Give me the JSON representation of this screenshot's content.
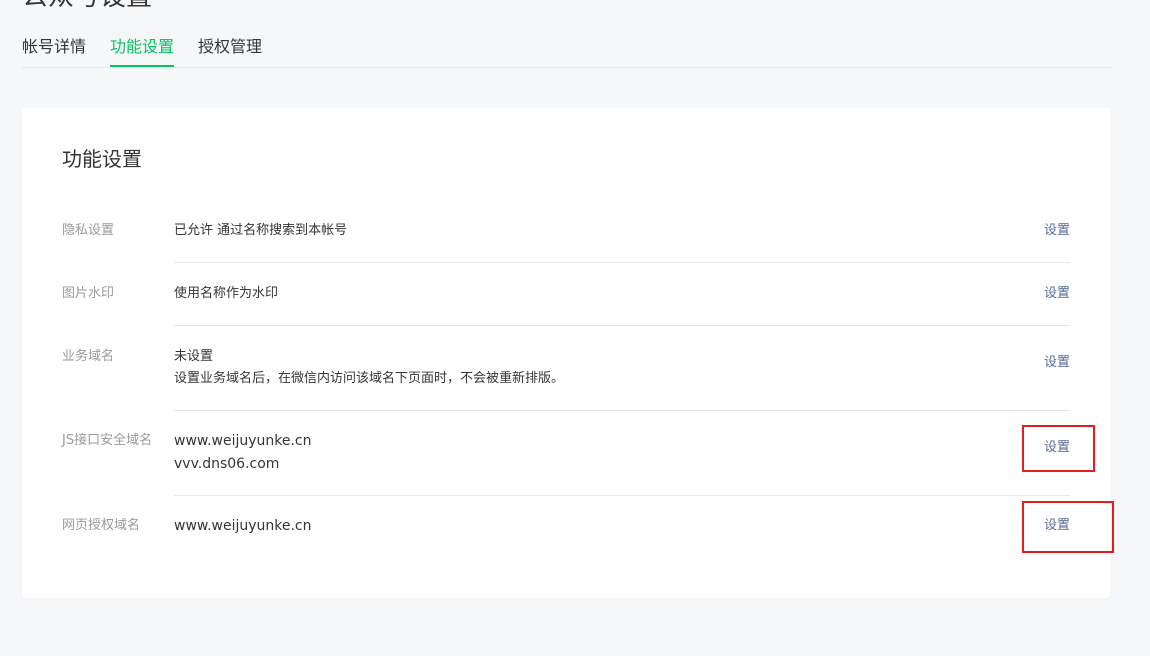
{
  "header": {
    "title": "公众号设置"
  },
  "tabs": [
    {
      "label": "帐号详情"
    },
    {
      "label": "功能设置"
    },
    {
      "label": "授权管理"
    }
  ],
  "active_tab": "功能设置",
  "card": {
    "title": "功能设置",
    "rows": [
      {
        "label": "隐私设置",
        "value_lines": [
          "已允许 通过名称搜索到本帐号"
        ],
        "action": "设置"
      },
      {
        "label": "图片水印",
        "value_lines": [
          "使用名称作为水印"
        ],
        "action": "设置"
      },
      {
        "label": "业务域名",
        "value_lines": [
          "未设置",
          "设置业务域名后，在微信内访问该域名下页面时，不会被重新排版。"
        ],
        "action": "设置"
      },
      {
        "label": "JS接口安全域名",
        "value_lines": [
          "www.weijuyunke.cn",
          "vvv.dns06.com"
        ],
        "action": "设置"
      },
      {
        "label": "网页授权域名",
        "value_lines": [
          "www.weijuyunke.cn"
        ],
        "action": "设置"
      }
    ]
  },
  "colors": {
    "accent_green": "#07c160",
    "link_blue": "#576b95",
    "highlight_red": "#e02020",
    "background": "#f6f7f9"
  }
}
